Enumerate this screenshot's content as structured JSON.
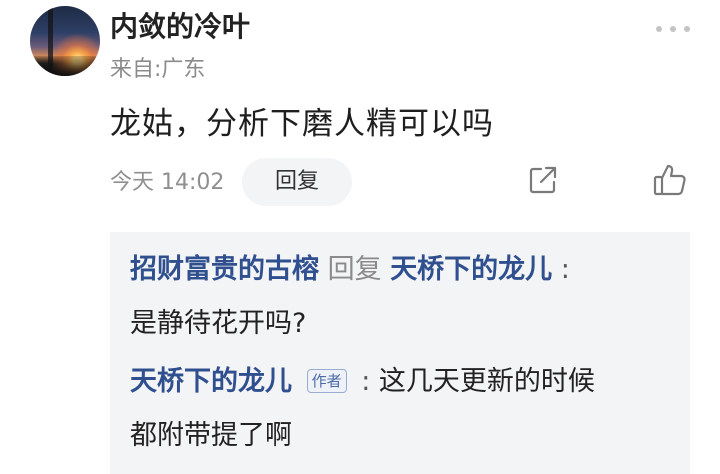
{
  "comment": {
    "username": "内敛的冷叶",
    "location": "来自:广东",
    "text": "龙姑，分析下磨人精可以吗",
    "timestamp": "今天 14:02",
    "reply_label": "回复"
  },
  "replies": [
    {
      "from": "招财富贵的古榕",
      "reply_word": "回复",
      "to": "天桥下的龙儿",
      "colon": ":",
      "line1_tail": "",
      "line2": "是静待花开吗?"
    },
    {
      "from": "天桥下的龙儿",
      "badge": "作者",
      "colon": ":",
      "line1_tail": "这几天更新的时候",
      "line2": "都附带提了啊"
    }
  ],
  "icons": {
    "more": "more-icon",
    "share": "share-icon",
    "like": "thumbs-up-icon"
  },
  "colors": {
    "name_blue": "#2f4f8f",
    "reply_bg": "#f3f4f6",
    "muted_gray": "#8f8f8f"
  }
}
